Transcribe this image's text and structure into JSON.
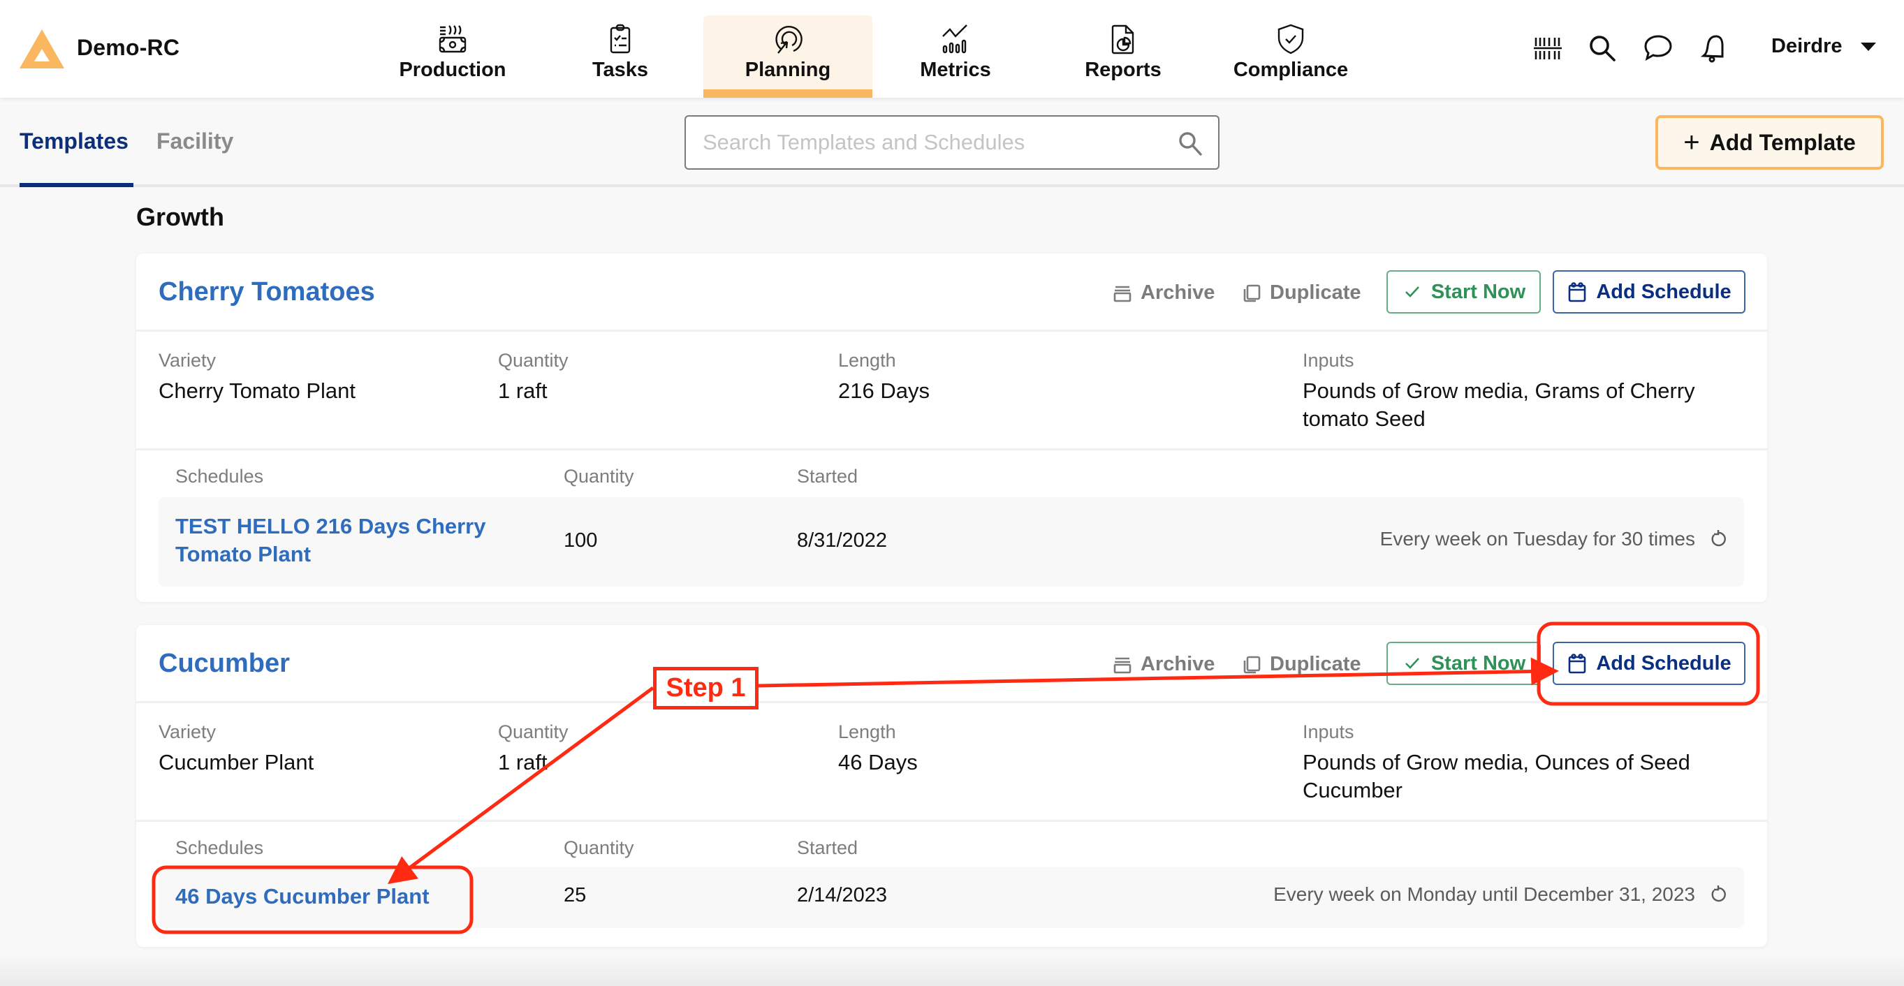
{
  "app": {
    "name": "Demo-RC",
    "brand_color": "#fbb760"
  },
  "nav": {
    "items": [
      {
        "label": "Production",
        "icon": "production-icon"
      },
      {
        "label": "Tasks",
        "icon": "clipboard-checklist-icon"
      },
      {
        "label": "Planning",
        "icon": "target-cursor-icon",
        "active": true
      },
      {
        "label": "Metrics",
        "icon": "metrics-chart-icon"
      },
      {
        "label": "Reports",
        "icon": "report-document-icon"
      },
      {
        "label": "Compliance",
        "icon": "shield-check-icon"
      }
    ]
  },
  "header_icons": [
    "barcode-icon",
    "search-icon",
    "chat-icon",
    "bell-icon"
  ],
  "user": {
    "name": "Deirdre"
  },
  "tabs": [
    {
      "label": "Templates",
      "active": true
    },
    {
      "label": "Facility",
      "active": false
    }
  ],
  "search": {
    "placeholder": "Search Templates and Schedules",
    "value": ""
  },
  "add_template": {
    "label": "Add Template"
  },
  "section": {
    "title": "Growth"
  },
  "labels": {
    "archive": "Archive",
    "duplicate": "Duplicate",
    "start_now": "Start Now",
    "add_schedule": "Add Schedule",
    "variety": "Variety",
    "quantity": "Quantity",
    "length": "Length",
    "inputs": "Inputs",
    "schedules": "Schedules",
    "started": "Started"
  },
  "templates": [
    {
      "title": "Cherry Tomatoes",
      "variety": "Cherry Tomato Plant",
      "quantity": "1 raft",
      "length": "216 Days",
      "inputs": "Pounds of Grow media, Grams of Cherry tomato Seed",
      "schedules": [
        {
          "name": "TEST HELLO 216 Days Cherry Tomato Plant",
          "quantity": "100",
          "started": "8/31/2022",
          "recurrence": "Every week on Tuesday for 30 times"
        }
      ]
    },
    {
      "title": "Cucumber",
      "variety": "Cucumber Plant",
      "quantity": "1 raft",
      "length": "46 Days",
      "inputs": "Pounds of Grow media, Ounces of Seed Cucumber",
      "schedules": [
        {
          "name": "46 Days Cucumber Plant",
          "quantity": "25",
          "started": "2/14/2023",
          "recurrence": "Every week on Monday until December 31, 2023"
        }
      ]
    }
  ],
  "annotation": {
    "label": "Step 1",
    "color": "#ff2a12",
    "targets": [
      "Add Schedule (Cucumber)",
      "46 Days Cucumber Plant"
    ]
  },
  "colors": {
    "link_blue": "#2f6cbd",
    "navy": "#0b2f80",
    "green": "#2f9158",
    "accent_orange": "#fbb760",
    "muted_gray": "#7d7d7d"
  }
}
